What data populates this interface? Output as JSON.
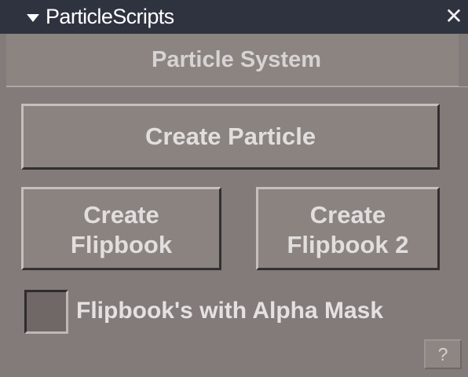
{
  "window": {
    "title": "ParticleScripts",
    "collapse_icon": "triangle-down-icon",
    "close_icon": "close-icon",
    "close_glyph": "✕"
  },
  "section": {
    "title": "Particle System"
  },
  "buttons": {
    "create_particle": "Create Particle",
    "create_flipbook": {
      "line1": "Create",
      "line2": "Flipbook"
    },
    "create_flipbook_2": {
      "line1": "Create",
      "line2": "Flipbook 2"
    }
  },
  "options": {
    "alpha_mask": {
      "label": "Flipbook's with Alpha Mask",
      "checked": false
    }
  },
  "help": {
    "label": "?",
    "icon": "help-icon"
  },
  "colors": {
    "titlebar": "#2f3340",
    "panel": "#827b79",
    "button": "#8a8380",
    "text": "#e2dede"
  }
}
